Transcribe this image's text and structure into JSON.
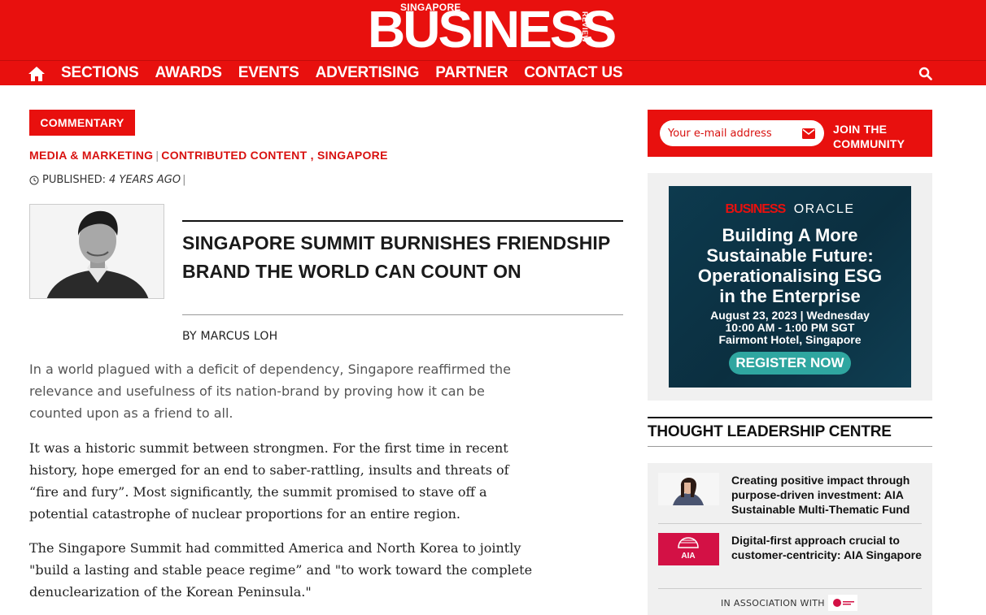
{
  "header": {
    "logo_small": "SINGAPORE",
    "logo_main": "BUSINESS",
    "logo_side": "REVIEW"
  },
  "nav": {
    "items": [
      "SECTIONS",
      "AWARDS",
      "EVENTS",
      "ADVERTISING",
      "PARTNER",
      "CONTACT US"
    ]
  },
  "article": {
    "badge": "COMMENTARY",
    "categories": [
      "MEDIA & MARKETING",
      "CONTRIBUTED CONTENT",
      "SINGAPORE"
    ],
    "published_label": "PUBLISHED:",
    "published_ago": "4 YEARS AGO",
    "title": "SINGAPORE SUMMIT BURNISHES FRIENDSHIP BRAND THE WORLD CAN COUNT ON",
    "byline": "BY MARCUS LOH",
    "lead": "In a world plagued with a deficit of dependency, Singapore reaffirmed the relevance and usefulness of its nation-brand by proving how it can be counted upon as a friend to all.",
    "paragraphs": [
      "It was a historic summit between strongmen. For the first time in recent history, hope emerged for an end to saber-rattling, insults and threats of “fire and fury”. Most significantly, the summit promised to stave off a potential catastrophe of nuclear proportions for an entire region.",
      "The Singapore Summit had committed America and North Korea to jointly \"build a lasting and stable peace regime” and \"to work toward the complete denuclearization of the Korean Peninsula.\""
    ]
  },
  "newsletter": {
    "placeholder": "Your e-mail address",
    "join_label": "JOIN THE COMMUNITY"
  },
  "ad": {
    "brand1": "BUSINESS",
    "brand2": "ORACLE",
    "title_lines": [
      "Building A More",
      "Sustainable Future:",
      "Operationalising ESG",
      "in the Enterprise"
    ],
    "date_lines": [
      "August 23, 2023 | Wednesday",
      "10:00 AM - 1:00 PM SGT",
      "Fairmont Hotel, Singapore"
    ],
    "cta": "REGISTER NOW"
  },
  "thought_leadership": {
    "heading": "THOUGHT LEADERSHIP CENTRE",
    "items": [
      {
        "title": "Creating positive impact through purpose-driven investment: AIA Sustainable Multi-Thematic Fund"
      },
      {
        "title": "Digital-first approach crucial to customer-centricity: AIA Singapore",
        "logo_text": "AIA"
      }
    ],
    "association": "IN ASSOCIATION WITH"
  },
  "colors": {
    "brand_red": "#e8100e",
    "ad_background": "#0d3a4e",
    "ad_cta": "#2fa6a0",
    "sidebar_panel": "#f0f0f0"
  }
}
